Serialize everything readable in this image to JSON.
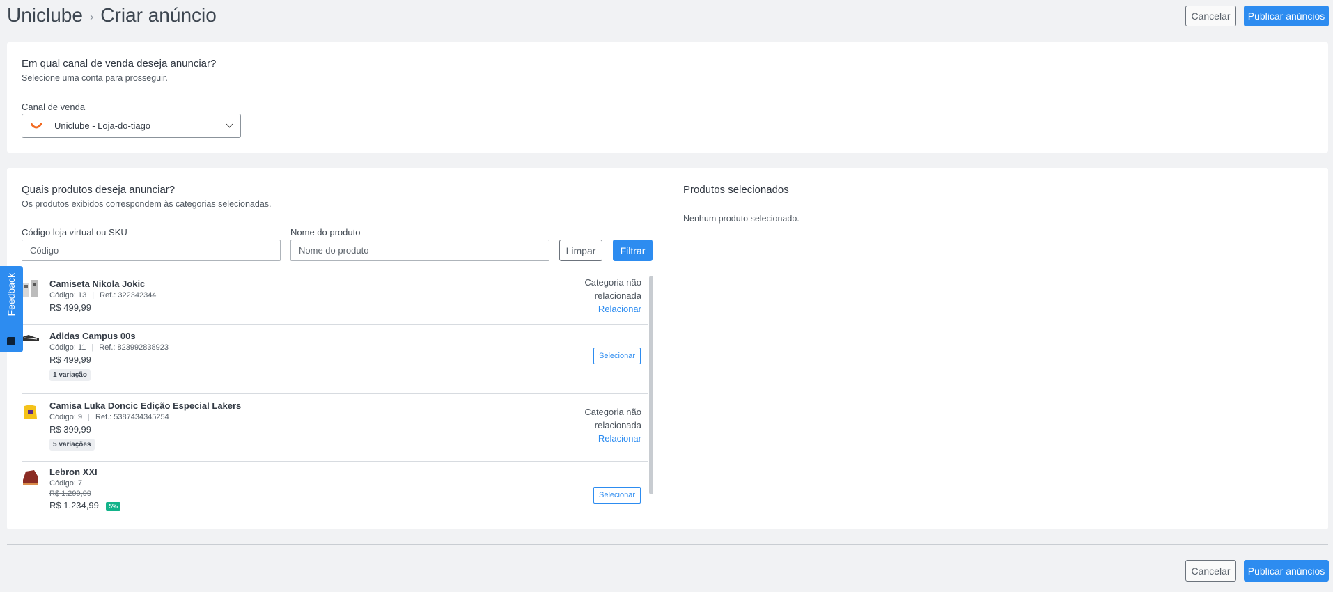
{
  "header": {
    "breadcrumb": [
      "Uniclube",
      "Criar anúncio"
    ],
    "separator": "›",
    "cancel_label": "Cancelar",
    "publish_label": "Publicar anúncios"
  },
  "channel": {
    "title": "Em qual canal de venda deseja anunciar?",
    "subtitle": "Selecione uma conta para prosseguir.",
    "field_label": "Canal de venda",
    "selected": "Uniclube - Loja-do-tiago"
  },
  "products": {
    "title": "Quais produtos deseja anunciar?",
    "subtitle": "Os produtos exibidos correspondem às categorias selecionadas.",
    "code_label": "Código loja virtual ou SKU",
    "code_placeholder": "Código",
    "name_label": "Nome do produto",
    "name_placeholder": "Nome do produto",
    "clear_label": "Limpar",
    "filter_label": "Filtrar",
    "items": [
      {
        "name": "Camiseta Nikola Jokic",
        "code": "Código: 13",
        "ref": "Ref.: 322342344",
        "price": "R$ 499,99",
        "status1": "Categoria não",
        "status2": "relacionada",
        "action": "Relacionar"
      },
      {
        "name": "Adidas Campus 00s",
        "code": "Código: 11",
        "ref": "Ref.: 823992838923",
        "price": "R$ 499,99",
        "variations": "1 variação",
        "action": "Selecionar"
      },
      {
        "name": "Camisa Luka Doncic Edição Especial Lakers",
        "code": "Código: 9",
        "ref": "Ref.: 5387434345254",
        "price": "R$ 399,99",
        "variations": "5 variações",
        "status1": "Categoria não",
        "status2": "relacionada",
        "action": "Relacionar"
      },
      {
        "name": "Lebron XXI",
        "code": "Código: 7",
        "old_price": "R$ 1.299,99",
        "price": "R$ 1.234,99",
        "discount": "5%",
        "action": "Selecionar"
      }
    ]
  },
  "selected": {
    "title": "Produtos selecionados",
    "empty": "Nenhum produto selecionado."
  },
  "feedback": {
    "label": "Feedback"
  },
  "footer": {
    "cancel_label": "Cancelar",
    "publish_label": "Publicar anúncios"
  },
  "colors": {
    "primary": "#2d8cf0",
    "discount": "#13b38a",
    "brand_logo": "#f26a21"
  }
}
